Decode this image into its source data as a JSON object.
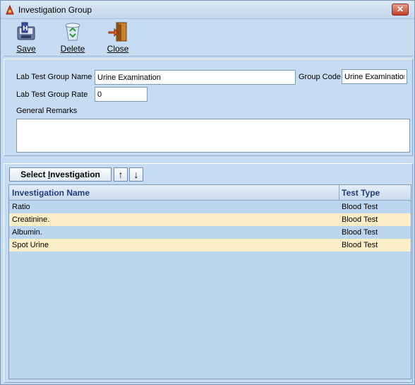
{
  "window": {
    "title": "Investigation Group",
    "close_glyph": "✕"
  },
  "toolbar": {
    "save_label": "Save",
    "delete_label": "Delete",
    "close_label": "Close"
  },
  "form": {
    "group_name_label": "Lab Test Group Name",
    "group_name_value": "Urine Examination",
    "group_code_label": "Group Code",
    "group_code_value": "Urine Examination",
    "rate_label": "Lab Test Group Rate",
    "rate_value": "0",
    "remarks_label": "General Remarks",
    "remarks_value": ""
  },
  "investigation": {
    "select_button": "Select Investigation",
    "up_glyph": "↑",
    "down_glyph": "↓"
  },
  "grid": {
    "columns": [
      "Investigation Name",
      "Test Type"
    ],
    "rows": [
      {
        "name": "Ratio",
        "type": "Blood Test"
      },
      {
        "name": "Creatinine.",
        "type": "Blood Test"
      },
      {
        "name": "Albumin.",
        "type": "Blood Test"
      },
      {
        "name": "Spot Urine",
        "type": "Blood Test"
      }
    ]
  },
  "colors": {
    "window_bg": "#c6dcf2",
    "grid_bg": "#bcd6ef",
    "alt_row": "#fcefc8",
    "header_text": "#1f3d7a"
  }
}
